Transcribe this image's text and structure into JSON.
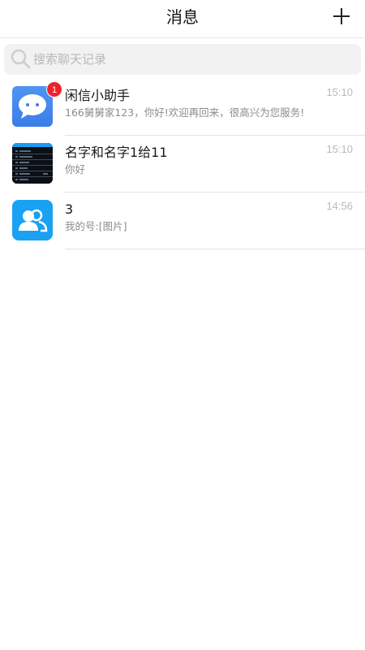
{
  "header": {
    "title": "消息",
    "add_icon": "plus-icon"
  },
  "search": {
    "placeholder": "搜索聊天记录",
    "value": "",
    "icon": "search-icon"
  },
  "conversations": [
    {
      "name": "闲信小助手",
      "message": "166舅舅家123，你好!欢迎再回来，很高兴为您服务!",
      "time": "15:10",
      "badge": "1",
      "avatar": "robot-avatar"
    },
    {
      "name": "名字和名字1给11",
      "message": "你好",
      "time": "15:10",
      "badge": "",
      "avatar": "screenshot-avatar"
    },
    {
      "name": "3",
      "message": "我的号:[图片]",
      "time": "14:56",
      "badge": "",
      "avatar": "group-avatar"
    }
  ],
  "colors": {
    "badge": "#f0212a",
    "group_avatar": "#1aa1f2",
    "robot_avatar": "#4f95f2",
    "time_text": "#b9b9b9",
    "message_text": "#8c8c8c"
  }
}
